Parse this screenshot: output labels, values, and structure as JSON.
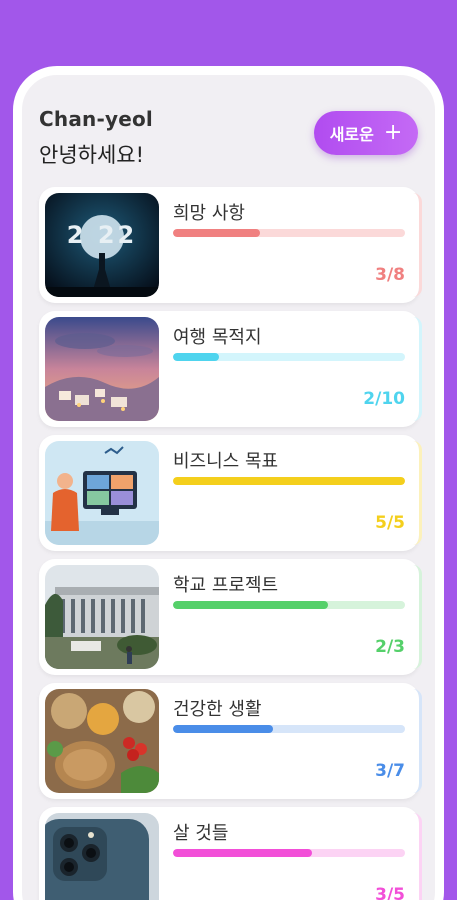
{
  "header": {
    "user_name": "Chan-yeol",
    "greeting": "안녕하세요!",
    "new_button_label": "새로운",
    "new_button_icon": "+"
  },
  "goals": [
    {
      "title": "희망 사항",
      "count_text": "3/8",
      "progress": 0.375,
      "accent": "#f08080",
      "accent_light": "#fbd9d9",
      "image": "moon-2022-image"
    },
    {
      "title": "여행 목적지",
      "count_text": "2/10",
      "progress": 0.2,
      "accent": "#4fd4ee",
      "accent_light": "#d3f5fc",
      "image": "santorini-image"
    },
    {
      "title": "비즈니스 목표",
      "count_text": "5/5",
      "progress": 1.0,
      "accent": "#f4cf1c",
      "accent_light": "#fcf1bb",
      "image": "video-call-image"
    },
    {
      "title": "학교 프로젝트",
      "count_text": "2/3",
      "progress": 0.667,
      "accent": "#55d06a",
      "accent_light": "#d6f3db",
      "image": "school-building-image"
    },
    {
      "title": "건강한 생활",
      "count_text": "3/7",
      "progress": 0.43,
      "accent": "#4a8de8",
      "accent_light": "#d6e5f9",
      "image": "healthy-food-image"
    },
    {
      "title": "살 것들",
      "count_text": "3/5",
      "progress": 0.6,
      "accent": "#f24fd8",
      "accent_light": "#fcd3f4",
      "image": "phone-image"
    }
  ]
}
